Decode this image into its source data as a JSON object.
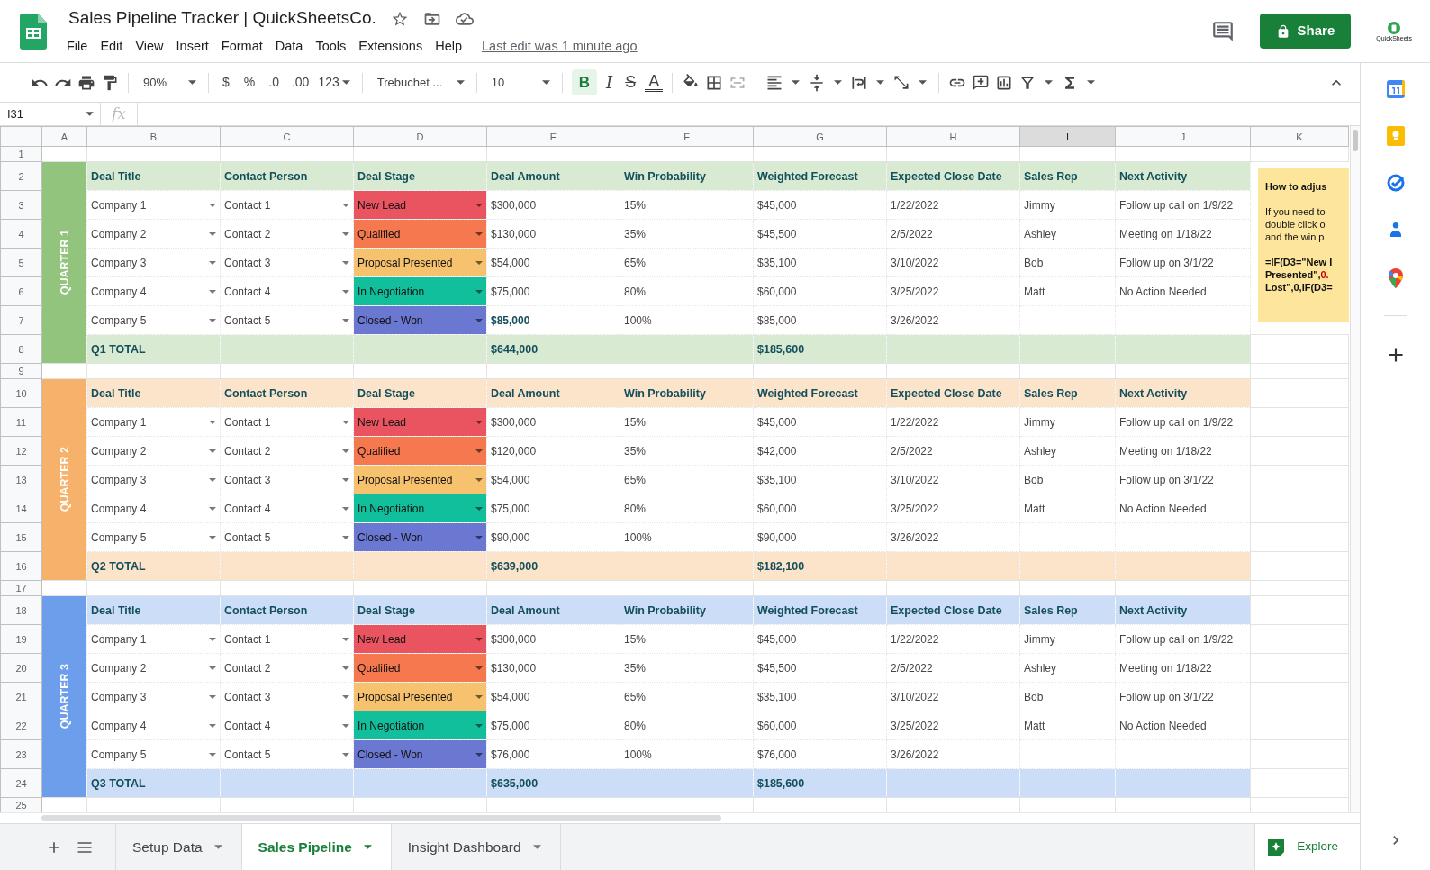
{
  "app": {
    "title": "Sales Pipeline Tracker | QuickSheetsCo.",
    "menu": [
      "File",
      "Edit",
      "View",
      "Insert",
      "Format",
      "Data",
      "Tools",
      "Extensions",
      "Help"
    ],
    "last_edit": "Last edit was 1 minute ago",
    "share": "Share",
    "account": "QuickSheets"
  },
  "toolbar": {
    "zoom": "90%",
    "currency": "$",
    "percent": "%",
    "decrease_decimals": ".0",
    "increase_decimals": ".00",
    "number_format": "123",
    "font": "Trebuchet ...",
    "font_size": "10",
    "bold": {
      "label": "B",
      "selected": true
    },
    "italic": "I",
    "strikethrough": "S",
    "text_color": "A"
  },
  "formula_bar": {
    "name_box": "I31",
    "fx": "fx"
  },
  "columns": [
    {
      "label": "A",
      "selected": false
    },
    {
      "label": "B",
      "selected": false
    },
    {
      "label": "C",
      "selected": false
    },
    {
      "label": "D",
      "selected": false
    },
    {
      "label": "E",
      "selected": false
    },
    {
      "label": "F",
      "selected": false
    },
    {
      "label": "G",
      "selected": false
    },
    {
      "label": "H",
      "selected": false
    },
    {
      "label": "I",
      "selected": true
    },
    {
      "label": "J",
      "selected": false
    },
    {
      "label": "K",
      "selected": false
    }
  ],
  "row_numbers": [
    "1",
    "2",
    "3",
    "4",
    "5",
    "6",
    "7",
    "8",
    "9",
    "10",
    "11",
    "12",
    "13",
    "14",
    "15",
    "16",
    "17",
    "18",
    "19",
    "20",
    "21",
    "22",
    "23",
    "24",
    "25"
  ],
  "sections": [
    {
      "label": "QUARTER 1",
      "color": "#93c47d",
      "headers": [
        "Deal Title",
        "Contact Person",
        "Deal Stage",
        "Deal Amount",
        "Win Probability",
        "Weighted Forecast",
        "Expected Close Date",
        "Sales Rep",
        "Next Activity"
      ],
      "rows": [
        {
          "deal": "Company 1",
          "contact": "Contact 1",
          "stage": "New Lead",
          "color": "#ea5460",
          "amount": "$300,000",
          "amount_bold": false,
          "probability": "15%",
          "forecast": "$45,000",
          "close_date": "1/22/2022",
          "rep": "Jimmy",
          "next": "Follow up call on 1/9/22"
        },
        {
          "deal": "Company 2",
          "contact": "Contact 2",
          "stage": "Qualified",
          "color": "#f6784f",
          "amount": "$130,000",
          "amount_bold": false,
          "probability": "35%",
          "forecast": "$45,500",
          "close_date": "2/5/2022",
          "rep": "Ashley",
          "next": "Meeting on 1/18/22"
        },
        {
          "deal": "Company 3",
          "contact": "Contact 3",
          "stage": "Proposal Presented",
          "color": "#f7c26d",
          "amount": "$54,000",
          "amount_bold": false,
          "probability": "65%",
          "forecast": "$35,100",
          "close_date": "3/10/2022",
          "rep": "Bob",
          "next": "Follow up on 3/1/22"
        },
        {
          "deal": "Company 4",
          "contact": "Contact 4",
          "stage": "In Negotiation",
          "color": "#12bf9c",
          "amount": "$75,000",
          "amount_bold": false,
          "probability": "80%",
          "forecast": "$60,000",
          "close_date": "3/25/2022",
          "rep": "Matt",
          "next": "No Action Needed"
        },
        {
          "deal": "Company 5",
          "contact": "Contact 5",
          "stage": "Closed - Won",
          "color": "#6b78d2",
          "amount": "$85,000",
          "amount_bold": true,
          "probability": "100%",
          "forecast": "$85,000",
          "close_date": "3/26/2022"
        }
      ],
      "total": {
        "label": "Q1 TOTAL",
        "amount": "$644,000",
        "forecast": "$185,600"
      }
    },
    {
      "label": "QUARTER 2",
      "color": "#f6b26b",
      "headers": [
        "Deal Title",
        "Contact Person",
        "Deal Stage",
        "Deal Amount",
        "Win Probability",
        "Weighted Forecast",
        "Expected Close Date",
        "Sales Rep",
        "Next Activity"
      ],
      "rows": [
        {
          "deal": "Company 1",
          "contact": "Contact 1",
          "stage": "New Lead",
          "color": "#ea5460",
          "amount": "$300,000",
          "amount_bold": false,
          "probability": "15%",
          "forecast": "$45,000",
          "close_date": "1/22/2022",
          "rep": "Jimmy",
          "next": "Follow up call on 1/9/22"
        },
        {
          "deal": "Company 2",
          "contact": "Contact 2",
          "stage": "Qualified",
          "color": "#f6784f",
          "amount": "$120,000",
          "amount_bold": false,
          "probability": "35%",
          "forecast": "$42,000",
          "close_date": "2/5/2022",
          "rep": "Ashley",
          "next": "Meeting on 1/18/22"
        },
        {
          "deal": "Company 3",
          "contact": "Contact 3",
          "stage": "Proposal Presented",
          "color": "#f7c26d",
          "amount": "$54,000",
          "amount_bold": false,
          "probability": "65%",
          "forecast": "$35,100",
          "close_date": "3/10/2022",
          "rep": "Bob",
          "next": "Follow up on 3/1/22"
        },
        {
          "deal": "Company 4",
          "contact": "Contact 4",
          "stage": "In Negotiation",
          "color": "#12bf9c",
          "amount": "$75,000",
          "amount_bold": false,
          "probability": "80%",
          "forecast": "$60,000",
          "close_date": "3/25/2022",
          "rep": "Matt",
          "next": "No Action Needed"
        },
        {
          "deal": "Company 5",
          "contact": "Contact 5",
          "stage": "Closed - Won",
          "color": "#6b78d2",
          "amount": "$90,000",
          "amount_bold": false,
          "probability": "100%",
          "forecast": "$90,000",
          "close_date": "3/26/2022"
        }
      ],
      "total": {
        "label": "Q2 TOTAL",
        "amount": "$639,000",
        "forecast": "$182,100"
      }
    },
    {
      "label": "QUARTER 3",
      "color": "#6d9eeb",
      "headers": [
        "Deal Title",
        "Contact Person",
        "Deal Stage",
        "Deal Amount",
        "Win Probability",
        "Weighted Forecast",
        "Expected Close Date",
        "Sales Rep",
        "Next Activity"
      ],
      "rows": [
        {
          "deal": "Company 1",
          "contact": "Contact 1",
          "stage": "New Lead",
          "color": "#ea5460",
          "amount": "$300,000",
          "amount_bold": false,
          "probability": "15%",
          "forecast": "$45,000",
          "close_date": "1/22/2022",
          "rep": "Jimmy",
          "next": "Follow up call on 1/9/22"
        },
        {
          "deal": "Company 2",
          "contact": "Contact 2",
          "stage": "Qualified",
          "color": "#f6784f",
          "amount": "$130,000",
          "amount_bold": false,
          "probability": "35%",
          "forecast": "$45,500",
          "close_date": "2/5/2022",
          "rep": "Ashley",
          "next": "Meeting on 1/18/22"
        },
        {
          "deal": "Company 3",
          "contact": "Contact 3",
          "stage": "Proposal Presented",
          "color": "#f7c26d",
          "amount": "$54,000",
          "amount_bold": false,
          "probability": "65%",
          "forecast": "$35,100",
          "close_date": "3/10/2022",
          "rep": "Bob",
          "next": "Follow up on 3/1/22"
        },
        {
          "deal": "Company 4",
          "contact": "Contact 4",
          "stage": "In Negotiation",
          "color": "#12bf9c",
          "amount": "$75,000",
          "amount_bold": false,
          "probability": "80%",
          "forecast": "$60,000",
          "close_date": "3/25/2022",
          "rep": "Matt",
          "next": "No Action Needed"
        },
        {
          "deal": "Company 5",
          "contact": "Contact 5",
          "stage": "Closed - Won",
          "color": "#6b78d2",
          "amount": "$76,000",
          "amount_bold": false,
          "probability": "100%",
          "forecast": "$76,000",
          "close_date": "3/26/2022"
        }
      ],
      "total": {
        "label": "Q3 TOTAL",
        "amount": "$635,000",
        "forecast": "$185,600"
      }
    }
  ],
  "note": {
    "title": "How to adjus",
    "lines": [
      "If you need to",
      "double click o",
      "and the win p"
    ],
    "formula": [
      [
        {
          "text": "=IF(D3=\"New I",
          "kind": "text"
        }
      ],
      [
        {
          "text": "Presented\",",
          "kind": "text"
        },
        {
          "text": "0.",
          "kind": "number"
        }
      ],
      [
        {
          "text": "Lost\",0,IF(D3=",
          "kind": "text"
        }
      ]
    ]
  },
  "sheet_tabs": [
    {
      "label": "Setup Data",
      "selected": false
    },
    {
      "label": "Sales Pipeline",
      "selected": true
    },
    {
      "label": "Insight Dashboard",
      "selected": false
    }
  ],
  "explore": "Explore"
}
